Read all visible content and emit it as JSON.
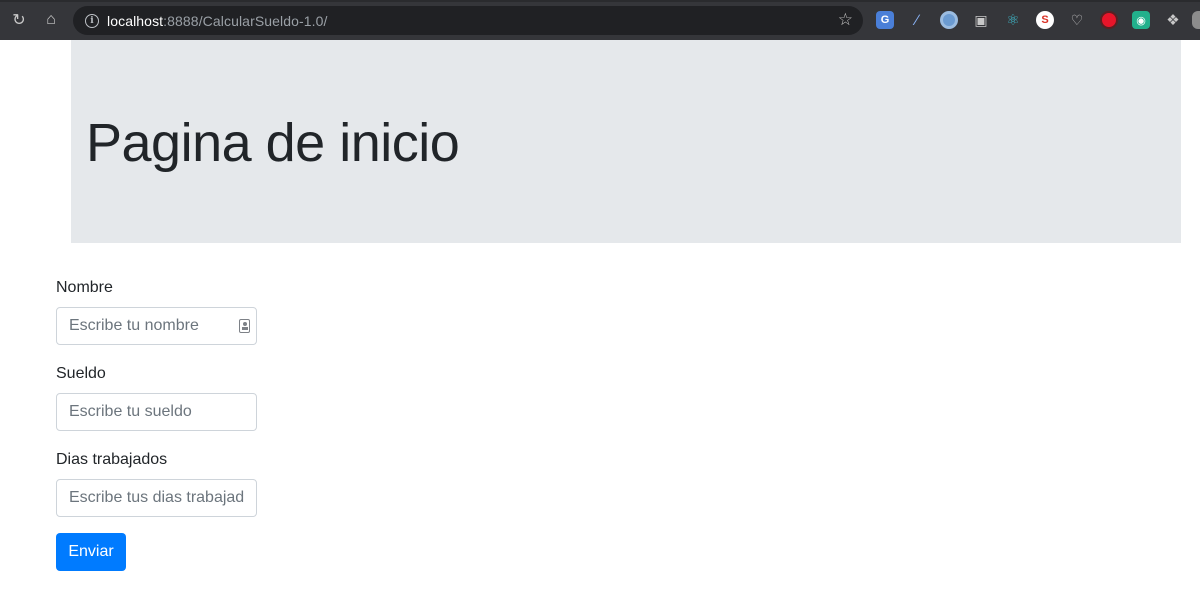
{
  "browser": {
    "url_host": "localhost",
    "url_rest": ":8888/CalcularSueldo-1.0/",
    "extensions": [
      "translate-icon",
      "pen-icon",
      "ring-icon",
      "camera-icon",
      "react-icon",
      "s-icon",
      "pocket-icon",
      "record-icon",
      "pin-icon",
      "puzzle-icon"
    ]
  },
  "page": {
    "title": "Pagina de inicio"
  },
  "form": {
    "nombre_label": "Nombre",
    "nombre_placeholder": "Escribe tu nombre",
    "sueldo_label": "Sueldo",
    "sueldo_placeholder": "Escribe tu sueldo",
    "dias_label": "Dias trabajados",
    "dias_placeholder": "Escribe tus dias trabajados",
    "submit_label": "Enviar"
  },
  "colors": {
    "primary": "#007bff",
    "jumbotron_bg": "#e9ecef",
    "chrome_bg": "#35363a"
  }
}
